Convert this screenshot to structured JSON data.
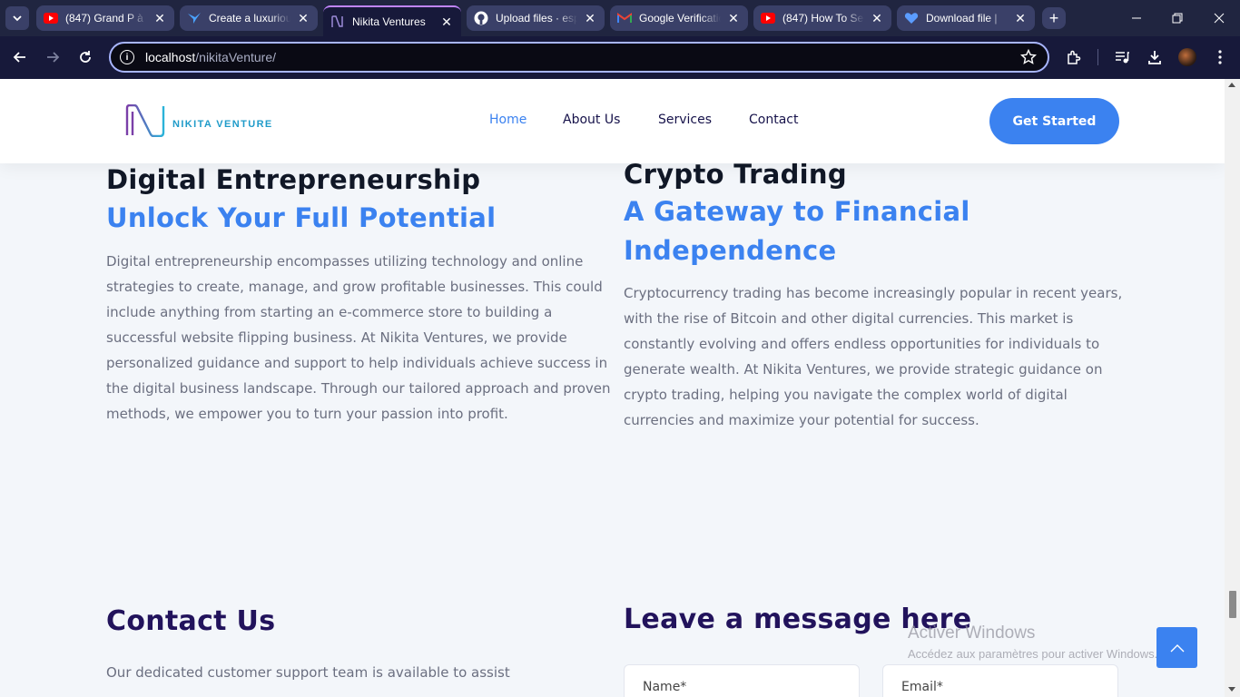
{
  "browser": {
    "tabs": [
      {
        "title": "(847) Grand P à c",
        "icon": "youtube-icon"
      },
      {
        "title": "Create a luxuriou",
        "icon": "bird-icon"
      },
      {
        "title": "Nikita Ventures",
        "icon": "nikita-icon"
      },
      {
        "title": "Upload files · esp",
        "icon": "github-icon"
      },
      {
        "title": "Google Verificatio",
        "icon": "gmail-icon"
      },
      {
        "title": "(847) How To Se",
        "icon": "youtube-icon"
      },
      {
        "title": "Download file | ",
        "icon": "heart-icon"
      }
    ],
    "url_host": "localhost",
    "url_path": "/nikitaVenture/"
  },
  "site": {
    "logo_text": "NIKITA VENTURE",
    "nav": [
      "Home",
      "About Us",
      "Services",
      "Contact"
    ],
    "cta": "Get Started"
  },
  "sections": {
    "digital": {
      "title": "Digital Entrepreneurship",
      "subtitle": "Unlock Your Full Potential",
      "lines": [
        "Digital entrepreneurship encompasses utilizing technology and online",
        "strategies to create, manage, and grow profitable businesses. This could",
        "include anything from starting an e-commerce store to building a",
        "successful website flipping business. At Nikita Ventures, we provide",
        "personalized guidance and support to help individuals achieve success in",
        "the digital business landscape. Through our tailored approach and proven",
        "methods, we empower you to turn your passion into profit."
      ]
    },
    "crypto": {
      "title": "Crypto Trading",
      "subtitle_1": "A Gateway to Financial",
      "subtitle_2": "Independence",
      "lines": [
        "Cryptocurrency trading has become increasingly popular in recent years,",
        "with the rise of Bitcoin and other digital currencies. This market is",
        "constantly evolving and offers endless opportunities for individuals to",
        "generate wealth. At Nikita Ventures, we provide strategic guidance on",
        "crypto trading, helping you navigate the complex world of digital",
        "currencies and maximize your potential for success."
      ]
    },
    "contact": {
      "title": "Contact Us",
      "text": "Our dedicated customer support team is available to assist",
      "form_title": "Leave a message here",
      "name_placeholder": "Name*",
      "email_placeholder": "Email*"
    }
  },
  "windows_watermark": {
    "line1": "Activer Windows",
    "line2": "Accédez aux paramètres pour activer Windows."
  },
  "colors": {
    "accent": "#3b82f0",
    "heading": "#111827",
    "navy": "#22135c",
    "body_text": "#6b6f80",
    "chrome_bg": "#202540"
  }
}
